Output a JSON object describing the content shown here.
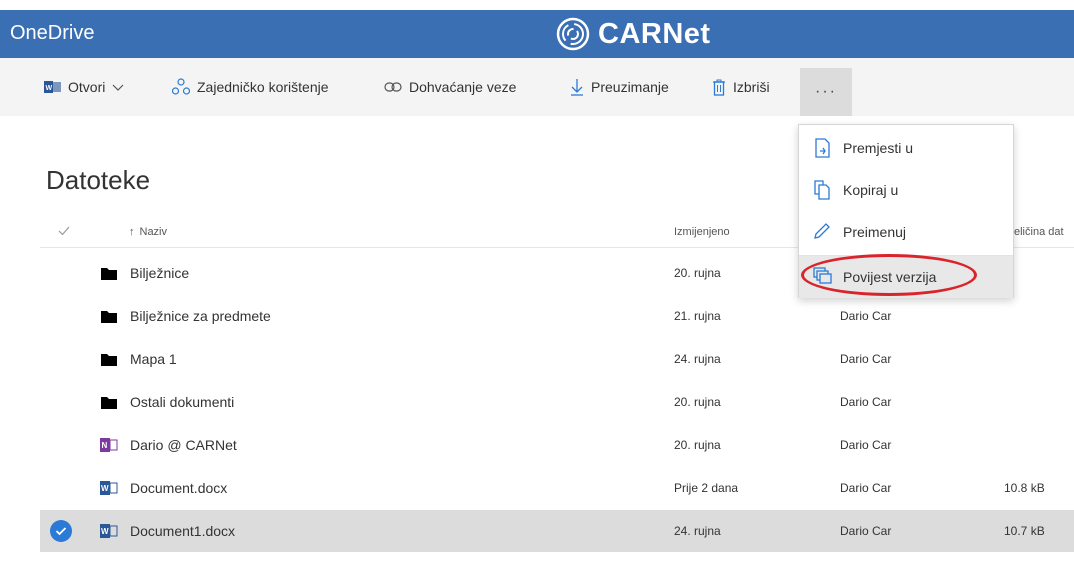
{
  "app": {
    "title": "OneDrive",
    "brand": "CARNet"
  },
  "toolbar": {
    "open": "Otvori",
    "share": "Zajedničko korištenje",
    "get_link": "Dohvaćanje veze",
    "download": "Preuzimanje",
    "delete": "Izbriši",
    "more": "···"
  },
  "page": {
    "title": "Datoteke"
  },
  "columns": {
    "name": "Naziv",
    "sort_arrow": "↑",
    "modified": "Izmijenjeno",
    "size": "eličina dat"
  },
  "files": [
    {
      "name": "Bilježnice",
      "modified": "20. rujna",
      "modified_by": "",
      "size": "",
      "icon": "folder-icon"
    },
    {
      "name": "Bilježnice za predmete",
      "modified": "21. rujna",
      "modified_by": "Dario Car",
      "size": "",
      "icon": "folder-icon"
    },
    {
      "name": "Mapa 1",
      "modified": "24. rujna",
      "modified_by": "Dario Car",
      "size": "",
      "icon": "folder-icon"
    },
    {
      "name": "Ostali dokumenti",
      "modified": "20. rujna",
      "modified_by": "Dario Car",
      "size": "",
      "icon": "folder-icon"
    },
    {
      "name": "Dario @ CARNet",
      "modified": "20. rujna",
      "modified_by": "Dario Car",
      "size": "",
      "icon": "onenote-icon"
    },
    {
      "name": "Document.docx",
      "modified": "Prije 2 dana",
      "modified_by": "Dario Car",
      "size": "10.8 kB",
      "icon": "word-icon"
    },
    {
      "name": "Document1.docx",
      "modified": "24. rujna",
      "modified_by": "Dario Car",
      "size": "10.7 kB",
      "icon": "word-icon",
      "selected": true
    }
  ],
  "context_menu": {
    "move": "Premjesti u",
    "copy": "Kopiraj u",
    "rename": "Preimenuj",
    "version_history": "Povijest verzija"
  },
  "colors": {
    "header": "#3a6fb4",
    "toolbar": "#f4f4f4",
    "selected_row": "#dcdcdc",
    "check": "#2b7ad6",
    "highlight_ellipse": "#d8242a"
  }
}
